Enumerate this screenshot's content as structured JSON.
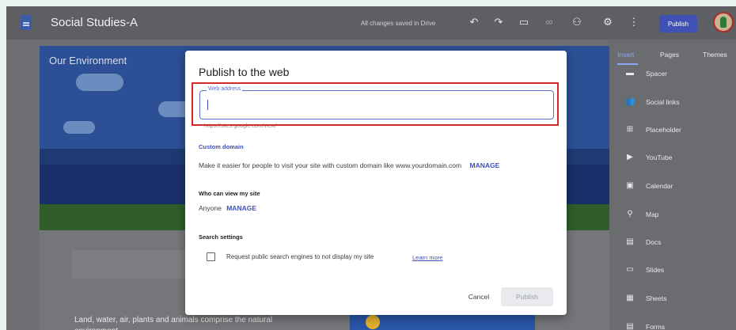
{
  "app": {
    "site_title": "Social Studies-A",
    "save_status": "All changes saved in Drive",
    "publish_label": "Publish"
  },
  "icons": {
    "undo": "undo-icon",
    "redo": "redo-icon",
    "preview": "preview-icon",
    "link": "link-icon",
    "share": "add-person-icon",
    "settings": "gear-icon",
    "more": "more-vert-icon"
  },
  "page": {
    "hero_title": "Our Environment",
    "body_text": "Land, water, air, plants and animals comprise the natural environment"
  },
  "panel": {
    "tabs": [
      "Insert",
      "Pages",
      "Themes"
    ],
    "items": [
      {
        "label": "Spacer",
        "icon": "spacer-icon"
      },
      {
        "label": "Social links",
        "icon": "people-icon"
      },
      {
        "label": "Placeholder",
        "icon": "plus-box-icon"
      },
      {
        "label": "YouTube",
        "icon": "youtube-icon"
      },
      {
        "label": "Calendar",
        "icon": "calendar-icon"
      },
      {
        "label": "Map",
        "icon": "map-pin-icon"
      },
      {
        "label": "Docs",
        "icon": "docs-icon"
      },
      {
        "label": "Slides",
        "icon": "slides-icon"
      },
      {
        "label": "Sheets",
        "icon": "sheets-icon"
      },
      {
        "label": "Forms",
        "icon": "forms-icon"
      }
    ]
  },
  "dialog": {
    "title": "Publish to the web",
    "web_address_label": "Web address",
    "web_address_value": "",
    "url_hint": "https://sites.google.com/view/",
    "custom_domain_heading": "Custom domain",
    "custom_domain_text": "Make it easier for people to visit your site with custom domain like www.yourdomain.com",
    "manage_label": "MANAGE",
    "who_can_view_heading": "Who can view my site",
    "who_can_view_value": "Anyone",
    "search_settings_heading": "Search settings",
    "search_checkbox_label": "Request public search engines to not display my site",
    "search_checkbox_checked": false,
    "learn_more": "Learn more",
    "cancel_label": "Cancel",
    "publish_label": "Publish"
  },
  "colors": {
    "accent": "#3f51b5",
    "highlight_box": "#d42a2a"
  }
}
